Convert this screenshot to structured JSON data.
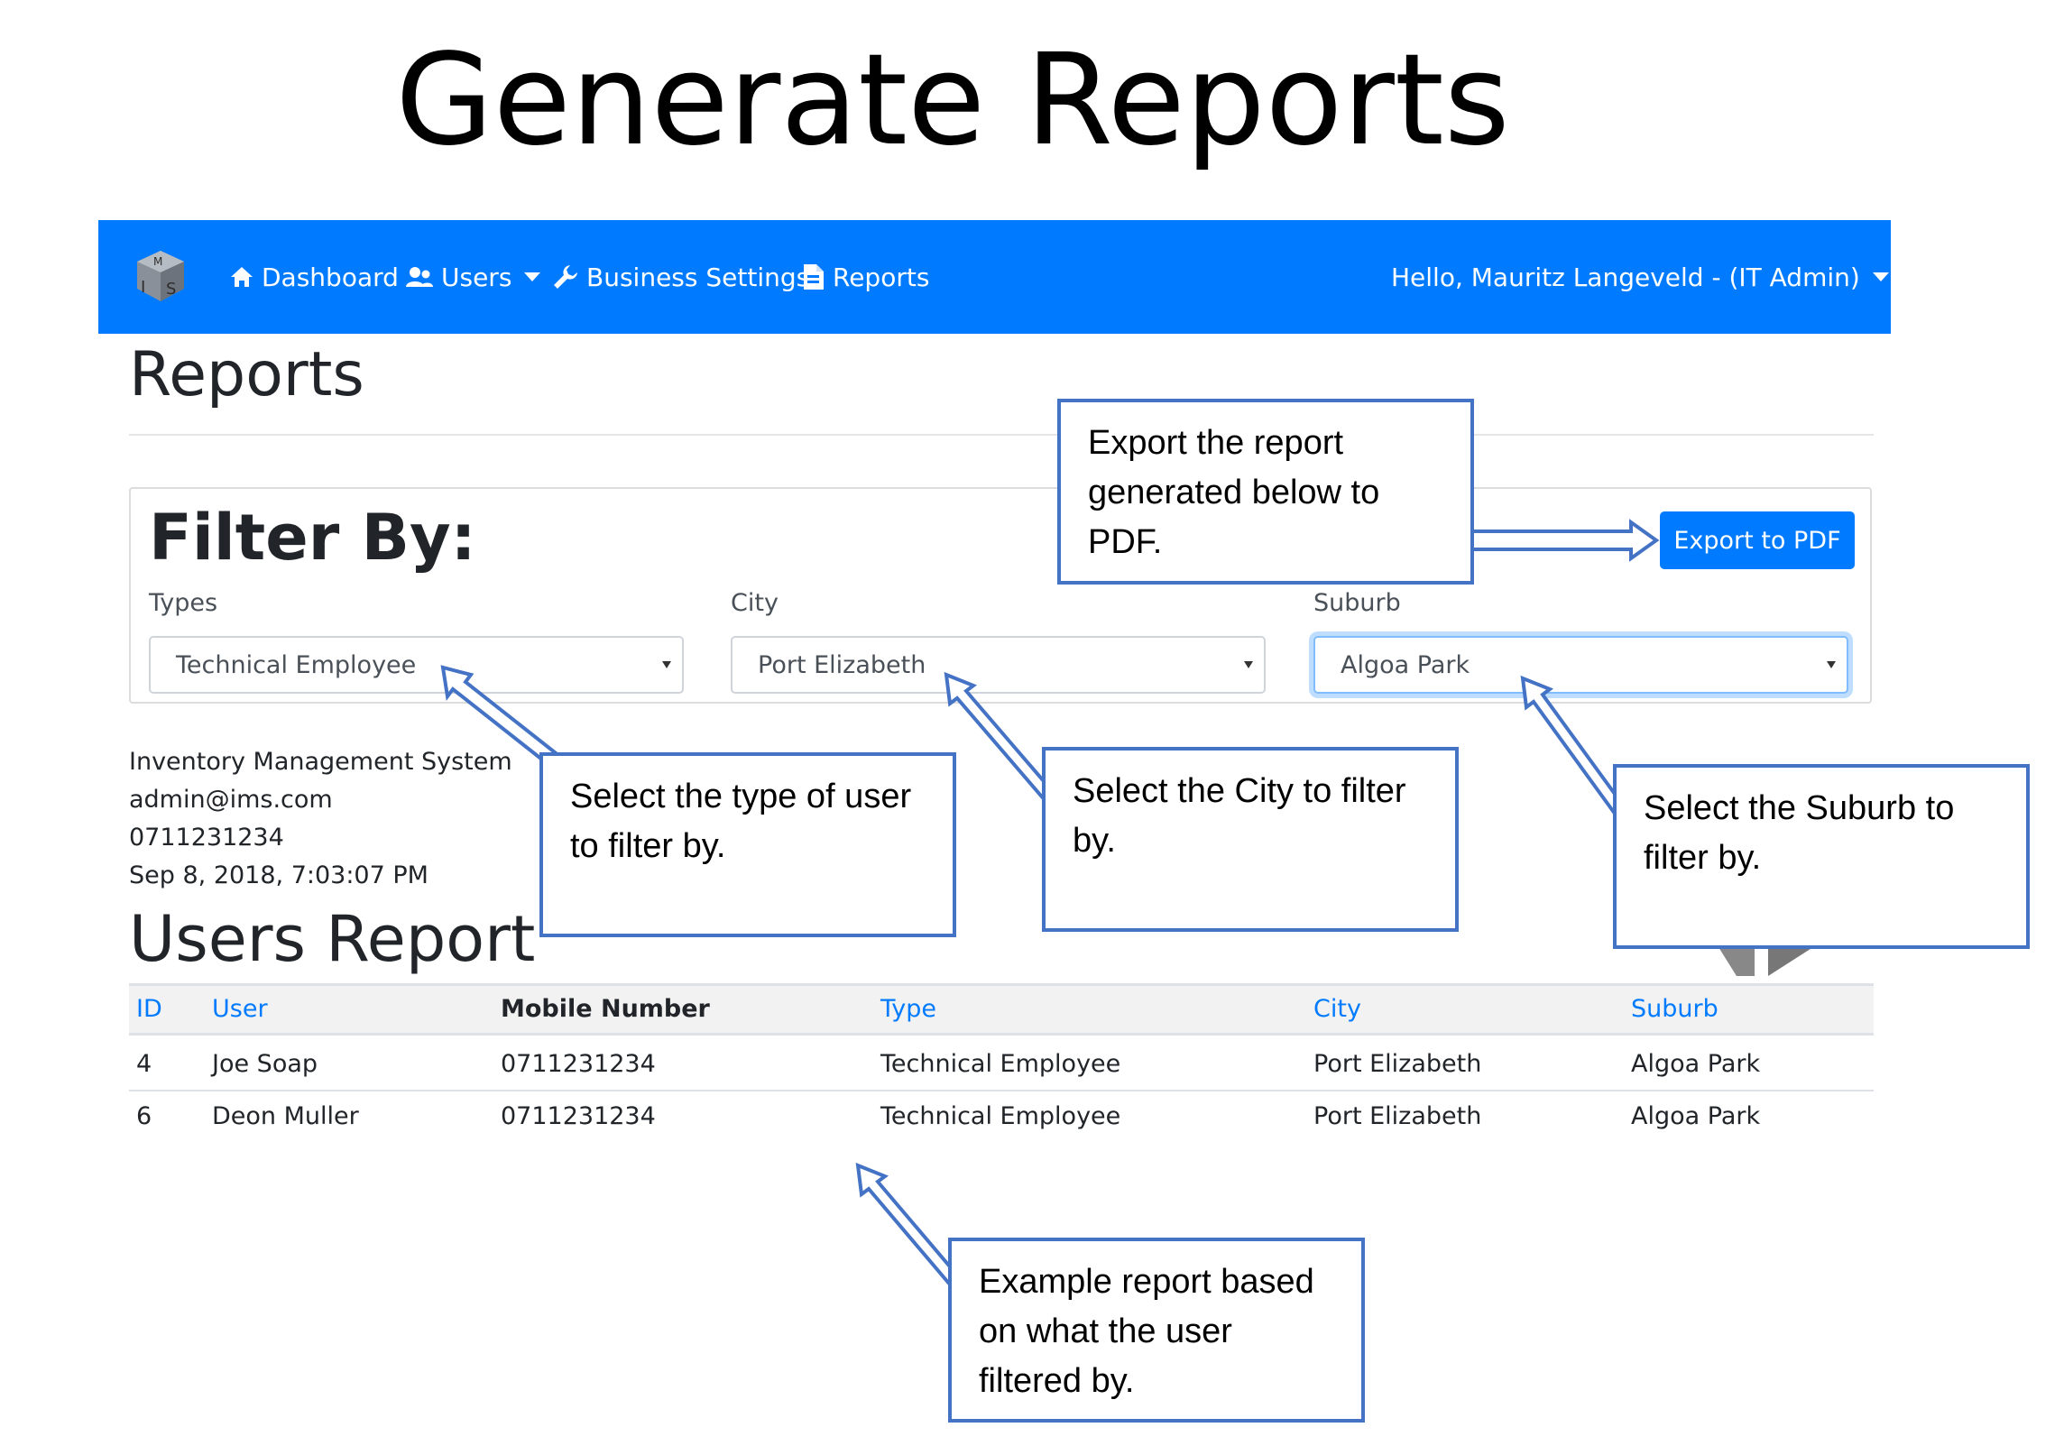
{
  "slide_title": "Generate Reports",
  "navbar": {
    "bg_color": "#007bff",
    "logo_icon": "ims-cube-logo",
    "items": [
      {
        "label": "Dashboard",
        "icon": "home-icon"
      },
      {
        "label": "Users",
        "icon": "users-icon"
      },
      {
        "label": "Business Settings",
        "icon": "wrench-icon"
      },
      {
        "label": "Reports",
        "icon": "file-icon"
      }
    ],
    "user_greeting": "Hello, Mauritz Langeveld - (IT Admin)"
  },
  "page": {
    "title": "Reports",
    "filter": {
      "title": "Filter By:",
      "types": {
        "label": "Types",
        "value": "Technical Employee"
      },
      "city": {
        "label": "City",
        "value": "Port Elizabeth"
      },
      "suburb": {
        "label": "Suburb",
        "value": "Algoa Park"
      },
      "export_label": "Export to PDF"
    },
    "info": {
      "company": "Inventory Management System",
      "email": "admin@ims.com",
      "phone": "0711231234",
      "date": "Sep 8, 2018, 7:03:07 PM"
    },
    "report": {
      "title": "Users Report",
      "columns": [
        "ID",
        "User",
        "Mobile Number",
        "Type",
        "City",
        "Suburb"
      ],
      "rows": [
        [
          "4",
          "Joe Soap",
          "0711231234",
          "Technical Employee",
          "Port Elizabeth",
          "Algoa Park"
        ],
        [
          "6",
          "Deon Muller",
          "0711231234",
          "Technical Employee",
          "Port Elizabeth",
          "Algoa Park"
        ]
      ]
    }
  },
  "callouts": {
    "export": "Export the report generated below to PDF.",
    "types": "Select the type of user to filter by.",
    "city": "Select the City to filter by.",
    "suburb": "Select the Suburb to filter by.",
    "report": "Example report based on what the user filtered by."
  },
  "accent_color": "#4472c4"
}
